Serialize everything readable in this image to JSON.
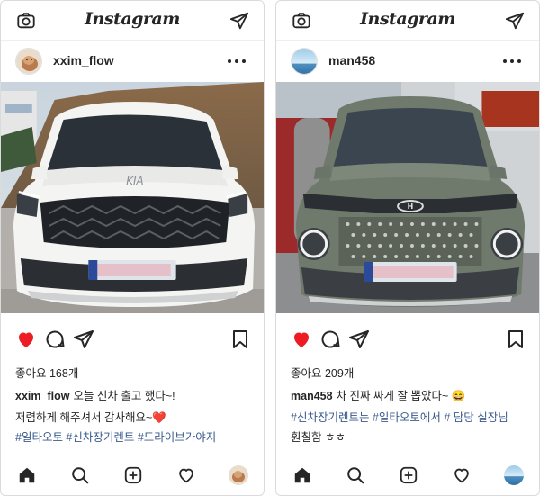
{
  "app": {
    "logo_text": "Instagram"
  },
  "posts": [
    {
      "username": "xxim_flow",
      "likes": "좋아요 168개",
      "caption_user": "xxim_flow",
      "caption_text": "오늘 신차 출고 했다~!",
      "caption_line2": "저렴하게 해주셔서 감사해요~",
      "caption_line2_emoji": "❤️",
      "tags": "#일타오토 #신차장기렌트 #드라이브가야지",
      "liked": true,
      "photo_subject": "white-suv",
      "colors": {
        "heart": "#ed1c24"
      }
    },
    {
      "username": "man458",
      "likes": "좋아요 209개",
      "caption_user": "man458",
      "caption_text": "차 진짜 싸게 잘 뽑았다~",
      "caption_emoji": "😄",
      "tags": "#신차장기렌트는 #일타오토에서 # 담당 실장님",
      "caption_line4": "훤칠함 ㅎㅎ",
      "liked": true,
      "photo_subject": "green-compact-suv",
      "colors": {
        "heart": "#ed1c24"
      }
    }
  ],
  "icons": {
    "top_left": "camera-icon",
    "top_right": "send-icon",
    "more": "more-options-icon",
    "actions": [
      "heart-icon",
      "comment-icon",
      "share-icon",
      "bookmark-icon"
    ],
    "bottom": [
      "home-icon",
      "search-icon",
      "add-post-icon",
      "activity-heart-icon",
      "profile-avatar"
    ]
  }
}
